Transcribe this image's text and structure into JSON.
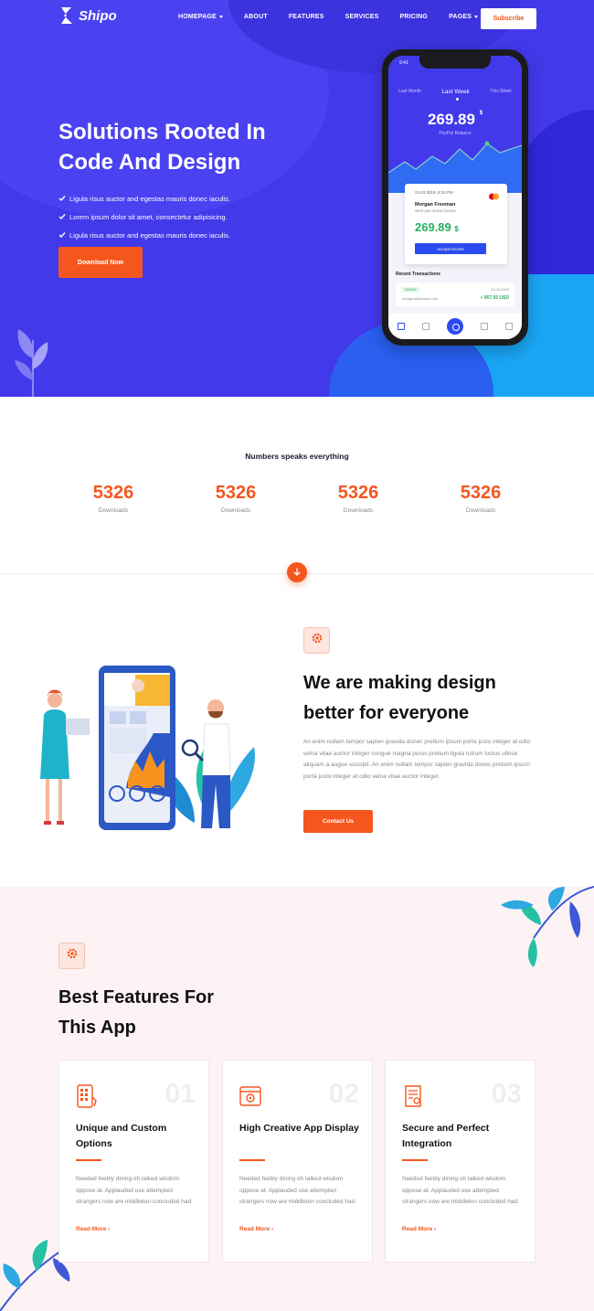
{
  "brand": {
    "name": "Shipo"
  },
  "nav": {
    "items": [
      {
        "label": "HOMEPAGE",
        "dropdown": true
      },
      {
        "label": "ABOUT",
        "dropdown": false
      },
      {
        "label": "FEATURES",
        "dropdown": false
      },
      {
        "label": "SERVICES",
        "dropdown": false
      },
      {
        "label": "PRICING",
        "dropdown": false
      },
      {
        "label": "PAGES",
        "dropdown": true
      }
    ],
    "subscribe_label": "Subscribe"
  },
  "hero": {
    "title_line1": "Solutions Rooted In",
    "title_line2": "Code And Design",
    "bullets": [
      "Ligula risus auctor and egestas mauris donec iaculis.",
      "Lorem ipsum dolor sit amet, consectetur adipisicing.",
      "Ligula risus auctor and egestas mauris donec iaculis."
    ],
    "download_label": "Download Now"
  },
  "phone": {
    "time": "9:41",
    "tabs": [
      "Last Month",
      "Last Week",
      "This Week"
    ],
    "active_tab": "Last Week",
    "balance": "269.89",
    "balance_currency": "$",
    "balance_label": "PayPal Balance",
    "card_date": "24.03.2019, 8:24 PM",
    "card_name": "Morgan Freeman",
    "card_sub": "Sent you some money",
    "card_amount": "269.89",
    "card_currency": "$",
    "card_button": "Accept Income",
    "recent_title": "Recent Transactions",
    "txn_badge": "PAYPAL",
    "txn_date": "24.03.2019",
    "txn_email": "morgan@domain.com",
    "txn_amount": "+ 567.55 USD"
  },
  "stats": {
    "heading": "Numbers speaks everything",
    "items": [
      {
        "value": "5326",
        "label": "Downloads"
      },
      {
        "value": "5326",
        "label": "Downloads"
      },
      {
        "value": "5326",
        "label": "Downloads"
      },
      {
        "value": "5326",
        "label": "Downloads"
      }
    ]
  },
  "design": {
    "title_line1": "We are making design",
    "title_line2": "better for everyone",
    "text": "An enim nullam tempor sapien gravida donec pretium ipsum porta justo integer at odio velna vitae auctor integer congue magna purus pretium ligula rutrum luctus ultrice aliquam a augue suscipit. An enim nullam tempor sapien gravida donec pretium ipsum porta justo integer at odio velna vitae auctor integer.",
    "contact_label": "Contact Us"
  },
  "features": {
    "title_line1": "Best Features For",
    "title_line2": "This App",
    "cards": [
      {
        "num": "01",
        "title": "Unique and Custom Options",
        "text": "Needed feebly dining oh talked wisdom oppose at. Applauded use attempted strangers now are middleton concluded had.",
        "link": "Read More"
      },
      {
        "num": "02",
        "title": "High Creative App Display",
        "text": "Needed feebly dining oh talked wisdom oppose at. Applauded use attempted strangers now are middleton concluded had.",
        "link": "Read More"
      },
      {
        "num": "03",
        "title": "Secure and Perfect Integration",
        "text": "Needed feebly dining oh talked wisdom oppose at. Applauded use attempted strangers now are middleton concluded had.",
        "link": "Read More"
      }
    ]
  },
  "colors": {
    "primary": "#4239ea",
    "accent": "#f5561e",
    "success": "#27ae60",
    "features_bg": "#fdf3f4"
  },
  "icons": [
    "logo-icon",
    "check-icon",
    "arrow-down-icon",
    "gear-icon",
    "phone-keypad-icon",
    "display-icon",
    "certificate-icon",
    "chevron-right-icon"
  ]
}
